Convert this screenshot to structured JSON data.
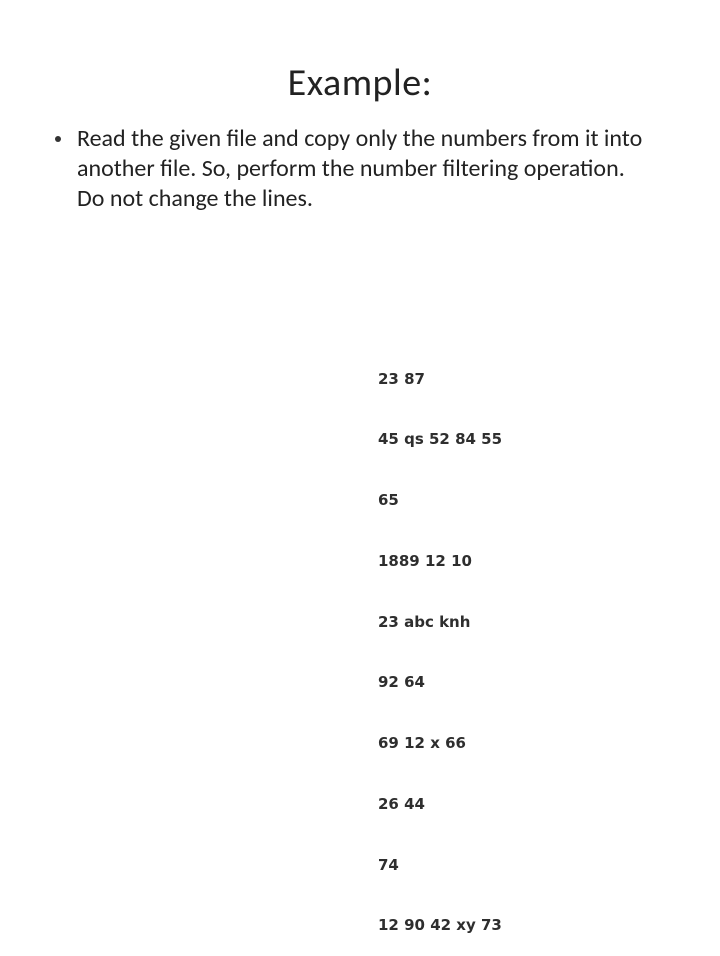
{
  "title": "Example:",
  "bullet": {
    "text": "Read the given file and copy only the numbers  from it into another file. So, perform the  number filtering operation. Do not change the  lines."
  },
  "sample_lines": [
    "23 87",
    "45 qs 52 84 55",
    "65",
    "1889 12 10",
    "23 abc knh",
    "92 64",
    "69 12 x 66",
    "26 44",
    "74",
    "12 90 42 xy 73"
  ]
}
